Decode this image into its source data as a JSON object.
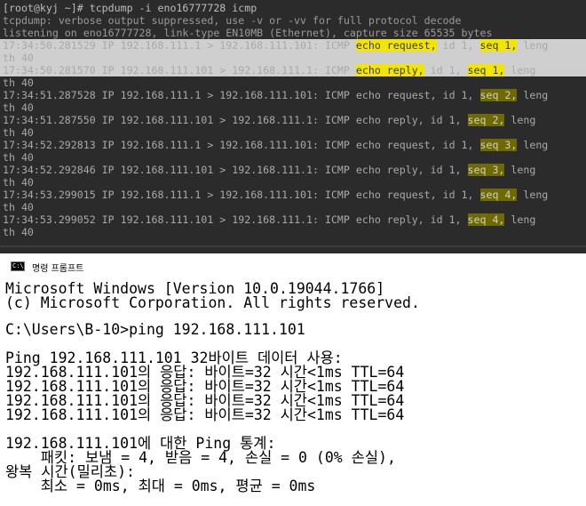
{
  "linux_terminal": {
    "command_line": "[root@kyj ~]# tcpdump -i eno16777728 icmp",
    "info_lines": [
      "tcpdump: verbose output suppressed, use -v or -vv for full protocol decode",
      "listening on eno16777728, link-type EN10MB (Ethernet), capture size 65535 bytes"
    ],
    "packets": [
      {
        "ts": "17:34:50.281529",
        "src": "192.168.111.1",
        "dst": "192.168.111.101",
        "type": "echo request",
        "id": "1",
        "seq": "1",
        "length": "40"
      },
      {
        "ts": "17:34:50.281570",
        "src": "192.168.111.101",
        "dst": "192.168.111.1",
        "type": "echo reply",
        "id": "1",
        "seq": "1",
        "length": "40"
      },
      {
        "ts": "17:34:51.287528",
        "src": "192.168.111.1",
        "dst": "192.168.111.101",
        "type": "echo request",
        "id": "1",
        "seq": "2",
        "length": "40"
      },
      {
        "ts": "17:34:51.287550",
        "src": "192.168.111.101",
        "dst": "192.168.111.1",
        "type": "echo reply",
        "id": "1",
        "seq": "2",
        "length": "40"
      },
      {
        "ts": "17:34:52.292813",
        "src": "192.168.111.1",
        "dst": "192.168.111.101",
        "type": "echo request",
        "id": "1",
        "seq": "3",
        "length": "40"
      },
      {
        "ts": "17:34:52.292846",
        "src": "192.168.111.101",
        "dst": "192.168.111.1",
        "type": "echo reply",
        "id": "1",
        "seq": "3",
        "length": "40"
      },
      {
        "ts": "17:34:53.299015",
        "src": "192.168.111.1",
        "dst": "192.168.111.101",
        "type": "echo request",
        "id": "1",
        "seq": "4",
        "length": "40"
      },
      {
        "ts": "17:34:53.299052",
        "src": "192.168.111.101",
        "dst": "192.168.111.1",
        "type": "echo reply",
        "id": "1",
        "seq": "4",
        "length": "40"
      }
    ]
  },
  "windows_cmd": {
    "title": "명령 프롬프트",
    "icon_text": "C:\\",
    "lines": [
      "Microsoft Windows [Version 10.0.19044.1766]",
      "(c) Microsoft Corporation. All rights reserved.",
      "",
      "C:\\Users\\B-10>ping 192.168.111.101",
      "",
      "Ping 192.168.111.101 32바이트 데이터 사용:",
      "192.168.111.101의 응답: 바이트=32 시간<1ms TTL=64",
      "192.168.111.101의 응답: 바이트=32 시간<1ms TTL=64",
      "192.168.111.101의 응답: 바이트=32 시간<1ms TTL=64",
      "192.168.111.101의 응답: 바이트=32 시간<1ms TTL=64",
      "",
      "192.168.111.101에 대한 Ping 통계:",
      "    패킷: 보냄 = 4, 받음 = 4, 손실 = 0 (0% 손실),",
      "왕복 시간(밀리초):",
      "    최소 = 0ms, 최대 = 0ms, 평균 = 0ms"
    ]
  }
}
